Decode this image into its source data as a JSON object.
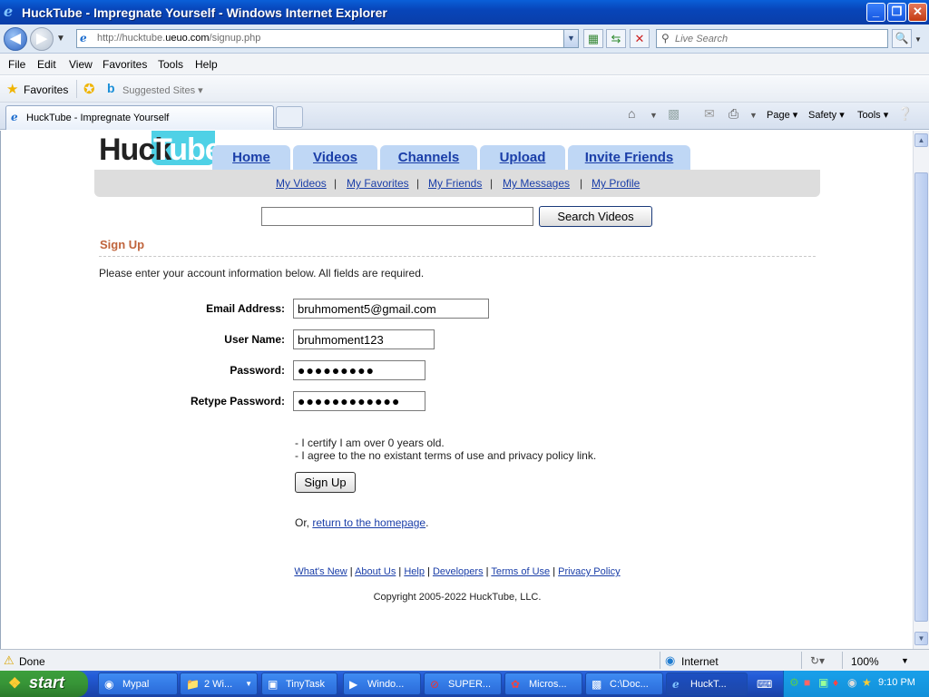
{
  "window": {
    "title": "HuckTube - Impregnate Yourself - Windows Internet Explorer",
    "controls": {
      "minimize": "_",
      "maximize": "❐",
      "close": "✕"
    }
  },
  "addressbar": {
    "url_prefix": "http://hucktube.",
    "url_domain": "ueuo.com",
    "url_path": "/signup.php",
    "search_placeholder": "Live Search"
  },
  "menu": [
    "File",
    "Edit",
    "View",
    "Favorites",
    "Tools",
    "Help"
  ],
  "favorites_bar": {
    "favorites_label": "Favorites",
    "suggested_label": "Suggested Sites ▾"
  },
  "tab": {
    "title": "HuckTube - Impregnate Yourself"
  },
  "command_bar": {
    "page": "Page ▾",
    "safety": "Safety ▾",
    "tools": "Tools ▾"
  },
  "site": {
    "logo": {
      "part1": "Huck",
      "part2": "Tube"
    },
    "nav": [
      "Home",
      "Videos",
      "Channels",
      "Upload",
      "Invite Friends"
    ],
    "subnav": [
      "My Videos",
      "My Favorites",
      "My Friends",
      "My Messages",
      "My Profile"
    ],
    "search_button": "Search Videos",
    "signup_title": "Sign Up",
    "intro": "Please enter your account information below. All fields are required.",
    "form": {
      "email_label": "Email Address:",
      "email_value": "bruhmoment5@gmail.com",
      "username_label": "User Name:",
      "username_value": "bruhmoment123",
      "password_label": "Password:",
      "password_value": "●●●●●●●●●",
      "retype_label": "Retype Password:",
      "retype_value": "●●●●●●●●●●●●"
    },
    "agree1": "- I certify I am over 0 years old.",
    "agree2": "- I agree to the no existant terms of use and privacy policy link.",
    "signup_button": "Sign Up",
    "return_prefix": "Or, ",
    "return_link": "return to the homepage",
    "return_suffix": ".",
    "footer_links": [
      "What's New",
      "About Us",
      "Help",
      "Developers",
      "Terms of Use",
      "Privacy Policy"
    ],
    "copyright": "Copyright 2005-2022 HuckTube, LLC."
  },
  "status": {
    "text": "Done",
    "zone": "Internet",
    "zoom": "100%"
  },
  "taskbar": {
    "start": "start",
    "items": [
      "Mypal",
      "2 Wi...",
      "TinyTask",
      "Windo...",
      "SUPER...",
      "Micros...",
      "C:\\Doc...",
      "HuckT..."
    ],
    "clock": "9:10 PM"
  },
  "colors": {
    "accent_title": "#c0643c",
    "link": "#1a3ea8",
    "nav_tab": "#bfd7f5",
    "logo_tube": "#4fd1e6"
  }
}
